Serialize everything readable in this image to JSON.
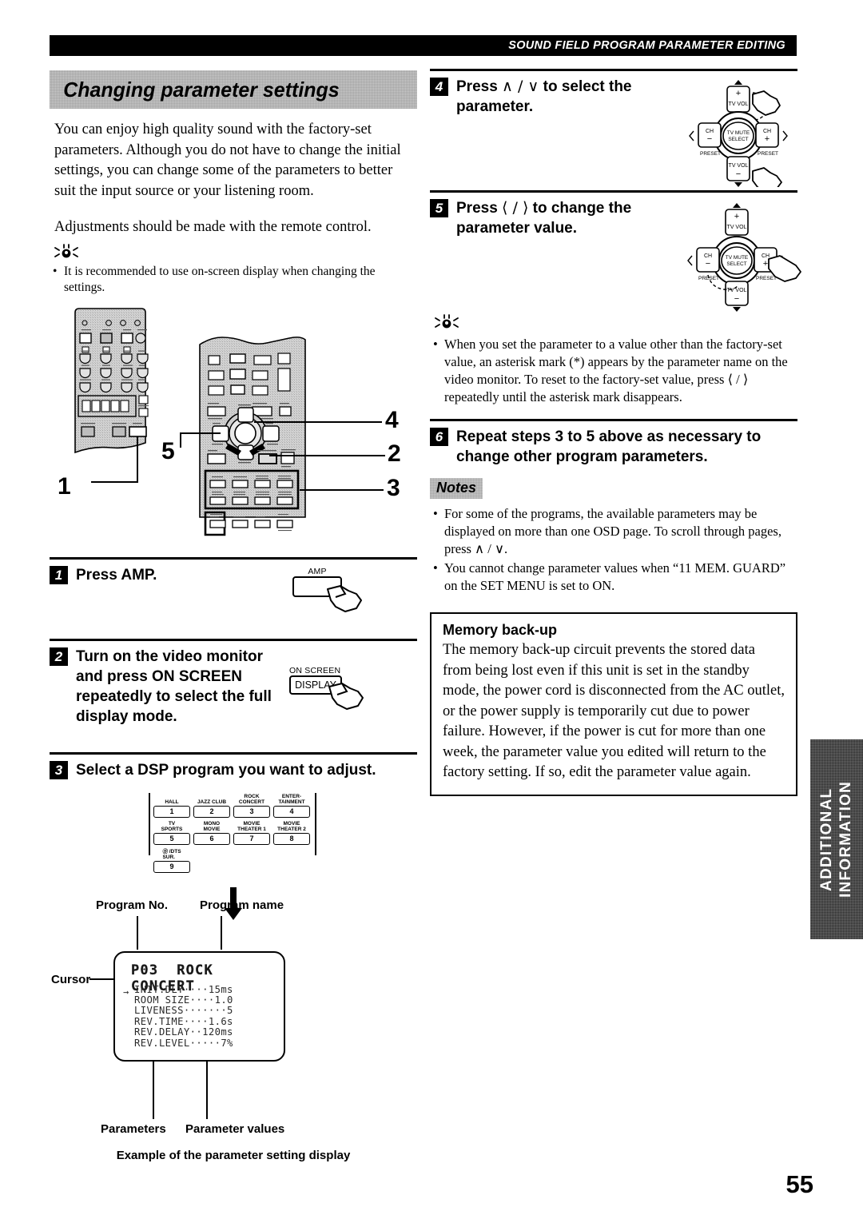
{
  "header": {
    "running_title": "SOUND FIELD PROGRAM PARAMETER EDITING"
  },
  "section": {
    "title": "Changing parameter settings",
    "intro": "You can enjoy high quality sound with the factory-set parameters. Although you do not have to change the initial settings, you can change some of the parameters to better suit the input source or your listening room.",
    "intro2": "Adjustments should be made with the remote control.",
    "tip1": "It is recommended to use on-screen display when changing the settings."
  },
  "remote_callouts": [
    "1",
    "5",
    "4",
    "2",
    "3"
  ],
  "steps": [
    {
      "num": "1",
      "text": "Press AMP.",
      "key_label": "AMP",
      "key_text": ""
    },
    {
      "num": "2",
      "text": "Turn on the video monitor and press ON SCREEN repeatedly to select the full display mode.",
      "key_label": "ON SCREEN",
      "key_text": "DISPLAY"
    },
    {
      "num": "3",
      "text": "Select a DSP program you want to adjust.",
      "key_label": "",
      "key_text": ""
    },
    {
      "num": "4",
      "text_pre": "Press ",
      "text_glyph": "∧ / ∨",
      "text_post": " to select the parameter."
    },
    {
      "num": "5",
      "text_pre": "Press ",
      "text_glyph": "⟨ / ⟩",
      "text_post": " to change the parameter value."
    },
    {
      "num": "6",
      "text": "Repeat steps 3 to 5 above as necessary to change other program parameters."
    }
  ],
  "keypad": {
    "buttons": [
      {
        "caption": "HALL",
        "num": "1"
      },
      {
        "caption": "JAZZ CLUB",
        "num": "2"
      },
      {
        "caption": "ROCK\nCONCERT",
        "num": "3"
      },
      {
        "caption": "ENTER-\nTAINMENT",
        "num": "4"
      },
      {
        "caption": "TV\nSPORTS",
        "num": "5"
      },
      {
        "caption": "MONO\nMOVIE",
        "num": "6"
      },
      {
        "caption": "MOVIE\nTHEATER 1",
        "num": "7"
      },
      {
        "caption": "MOVIE\nTHEATER 2",
        "num": "8"
      }
    ],
    "extra": {
      "caption": "Ⓓ /DTS\nSUR.",
      "num": "9"
    }
  },
  "osd": {
    "label_program_no": "Program No.",
    "label_program_name": "Program name",
    "label_cursor": "Cursor",
    "label_parameters": "Parameters",
    "label_parameter_values": "Parameter values",
    "caption": "Example of the parameter setting display",
    "program_no": "P03",
    "program_name": "ROCK CONCERT",
    "cursor_glyph": "→",
    "lines": [
      {
        "name": "INIT.DLY",
        "dots": "····",
        "value": "15ms"
      },
      {
        "name": "ROOM SIZE",
        "dots": "····",
        "value": "1.0"
      },
      {
        "name": "LIVENESS",
        "dots": "·······",
        "value": "5"
      },
      {
        "name": "REV.TIME",
        "dots": "····",
        "value": "1.6s"
      },
      {
        "name": "REV.DELAY",
        "dots": "··",
        "value": "120ms"
      },
      {
        "name": "REV.LEVEL",
        "dots": "·····",
        "value": "7%"
      }
    ],
    "raw_lines": [
      "INIT.DLY····15ms",
      "ROOM SIZE····1.0",
      "LIVENESS·······5",
      "REV.TIME····1.6s",
      "REV.DELAY··120ms",
      "REV.LEVEL·····7%"
    ]
  },
  "remote_pad": {
    "up_plus": "+",
    "up_label": "TV VOL",
    "down_label": "TV VOL",
    "down_minus": "−",
    "left_label": "CH",
    "left_minus": "−",
    "right_label": "CH",
    "right_plus": "+",
    "preset_left": "PRESET",
    "preset_right": "PRESET",
    "center_line1": "TV MUTE",
    "center_line2": "SELECT"
  },
  "tips": {
    "tip2": "When you set the parameter to a value other than the factory-set value, an asterisk mark (*) appears by the parameter name on the video monitor. To reset to the factory-set value, press ⟨ / ⟩ repeatedly until the asterisk mark disappears."
  },
  "notes": {
    "label": "Notes",
    "items": [
      "For some of the programs, the available parameters may be displayed on more than one OSD page. To scroll through pages, press ∧ / ∨.",
      "You cannot change parameter values when “11 MEM. GUARD” on the SET MENU is set to ON."
    ]
  },
  "memory_box": {
    "heading": "Memory back-up",
    "body": "The memory back-up circuit prevents the stored data from being lost even if this unit is set in the standby mode, the power cord is disconnected from the AC outlet, or the power supply is temporarily cut due to power failure. However, if the power is cut for more than one week, the parameter value you edited will return to the factory setting. If so, edit the parameter value again."
  },
  "side_tab": {
    "text": "ADDITIONAL\nINFORMATION"
  },
  "page_number": "55"
}
